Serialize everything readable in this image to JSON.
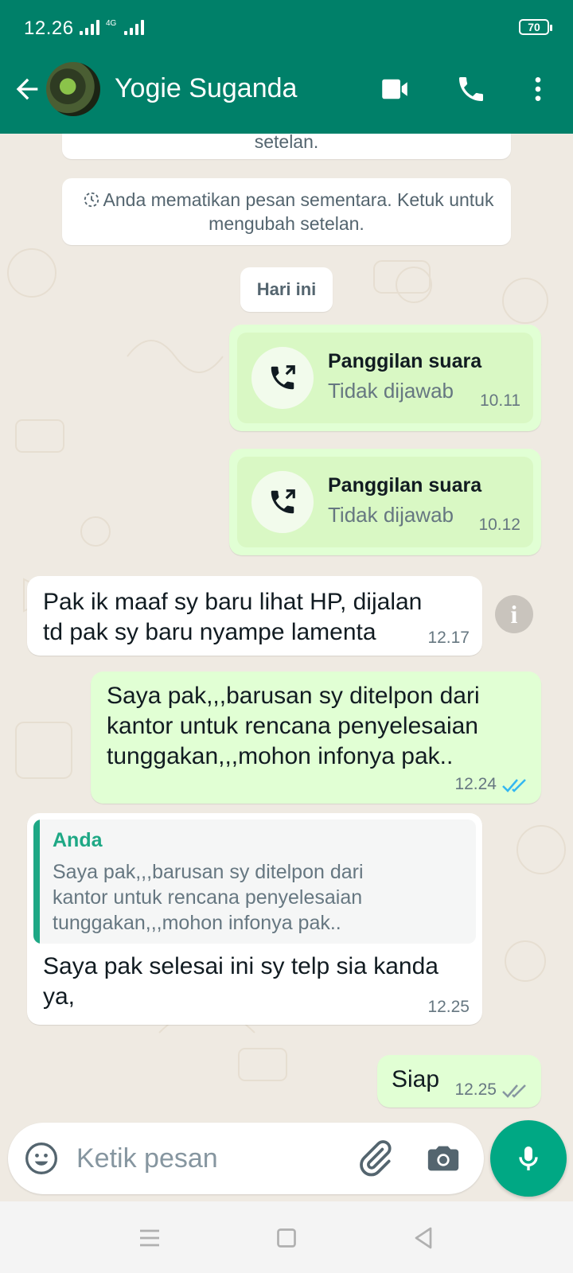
{
  "status_bar": {
    "time": "12.26",
    "network": "4G",
    "battery": "70"
  },
  "header": {
    "contact_name": "Yogie Suganda"
  },
  "system_messages": {
    "cut_off_text": "setelan.",
    "disappearing_notice": "Anda mematikan pesan sementara. Ketuk untuk mengubah setelan."
  },
  "date_chip": "Hari ini",
  "calls": [
    {
      "title": "Panggilan suara",
      "status": "Tidak dijawab",
      "time": "10.11"
    },
    {
      "title": "Panggilan suara",
      "status": "Tidak dijawab",
      "time": "10.12"
    }
  ],
  "messages": [
    {
      "direction": "in",
      "text_line1": "Pak ik maaf sy baru lihat HP, dijalan",
      "text_line2": "td pak sy baru nyampe lamenta",
      "time": "12.17"
    },
    {
      "direction": "out",
      "text_line1": "Saya pak,,,barusan sy ditelpon dari",
      "text_line2": "kantor untuk rencana penyelesaian",
      "text_line3": "tunggakan,,,mohon infonya pak..",
      "time": "12.24",
      "read": true
    },
    {
      "direction": "in",
      "quote_author": "Anda",
      "quote_line1": "Saya pak,,,barusan sy ditelpon dari",
      "quote_line2": "kantor untuk rencana penyelesaian",
      "quote_line3": "tunggakan,,,mohon infonya pak..",
      "text_line1": "Saya pak selesai ini sy telp sia kanda",
      "text_line2": "ya,",
      "time": "12.25"
    },
    {
      "direction": "out",
      "text_line1": "Siap",
      "time": "12.25",
      "read": false
    }
  ],
  "composer": {
    "placeholder": "Ketik pesan"
  },
  "icons": {
    "back": "arrow-left-icon",
    "video": "video-call-icon",
    "voice": "phone-icon",
    "menu": "more-vert-icon",
    "emoji": "emoji-icon",
    "attach": "paperclip-icon",
    "camera": "camera-icon",
    "mic": "mic-icon"
  },
  "colors": {
    "header": "#008069",
    "outgoing": "#e1ffd4",
    "incoming": "#ffffff",
    "accent": "#00a884",
    "read_tick": "#34b7f1"
  }
}
